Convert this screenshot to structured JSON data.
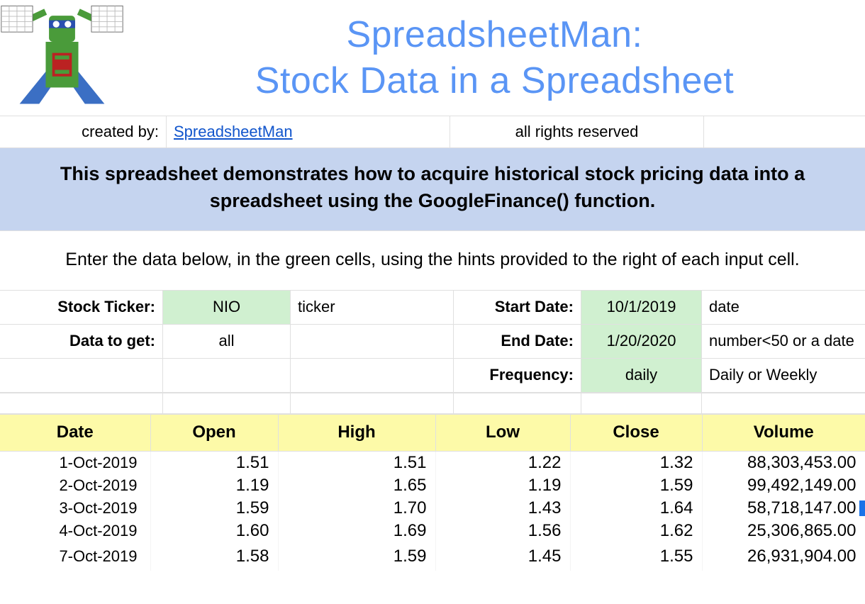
{
  "header": {
    "title_line1": "SpreadsheetMan:",
    "title_line2": "Stock Data in a Spreadsheet",
    "created_by_label": "created by:",
    "created_by_link_text": "SpreadsheetMan",
    "rights": "all rights reserved"
  },
  "banner": "This spreadsheet demonstrates how to acquire historical stock pricing data into a spreadsheet using the GoogleFinance() function.",
  "instruction": "Enter the data below, in the green cells, using the hints provided to the right of each input cell.",
  "inputs": {
    "ticker_label": "Stock Ticker:",
    "ticker_value": "NIO",
    "ticker_hint": "ticker",
    "data_label": "Data to get:",
    "data_value": "all",
    "start_label": "Start Date:",
    "start_value": "10/1/2019",
    "start_hint": "date",
    "end_label": "End Date:",
    "end_value": "1/20/2020",
    "end_hint": "number<50 or a date",
    "freq_label": "Frequency:",
    "freq_value": "daily",
    "freq_hint": "Daily or Weekly"
  },
  "table": {
    "headers": [
      "Date",
      "Open",
      "High",
      "Low",
      "Close",
      "Volume"
    ],
    "rows": [
      {
        "date": "1-Oct-2019",
        "open": "1.51",
        "high": "1.51",
        "low": "1.22",
        "close": "1.32",
        "volume": "88,303,453.00"
      },
      {
        "date": "2-Oct-2019",
        "open": "1.19",
        "high": "1.65",
        "low": "1.19",
        "close": "1.59",
        "volume": "99,492,149.00"
      },
      {
        "date": "3-Oct-2019",
        "open": "1.59",
        "high": "1.70",
        "low": "1.43",
        "close": "1.64",
        "volume": "58,718,147.00"
      },
      {
        "date": "4-Oct-2019",
        "open": "1.60",
        "high": "1.69",
        "low": "1.56",
        "close": "1.62",
        "volume": "25,306,865.00"
      },
      {
        "date": "7-Oct-2019",
        "open": "1.58",
        "high": "1.59",
        "low": "1.45",
        "close": "1.55",
        "volume": "26,931,904.00"
      }
    ]
  },
  "chart_data": {
    "type": "table",
    "title": "Historical Stock Pricing Data (GoogleFinance)",
    "columns": [
      "Date",
      "Open",
      "High",
      "Low",
      "Close",
      "Volume"
    ],
    "rows": [
      [
        "1-Oct-2019",
        1.51,
        1.51,
        1.22,
        1.32,
        88303453.0
      ],
      [
        "2-Oct-2019",
        1.19,
        1.65,
        1.19,
        1.59,
        99492149.0
      ],
      [
        "3-Oct-2019",
        1.59,
        1.7,
        1.43,
        1.64,
        58718147.0
      ],
      [
        "4-Oct-2019",
        1.6,
        1.69,
        1.56,
        1.62,
        25306865.0
      ],
      [
        "7-Oct-2019",
        1.58,
        1.59,
        1.45,
        1.55,
        26931904.0
      ]
    ]
  }
}
